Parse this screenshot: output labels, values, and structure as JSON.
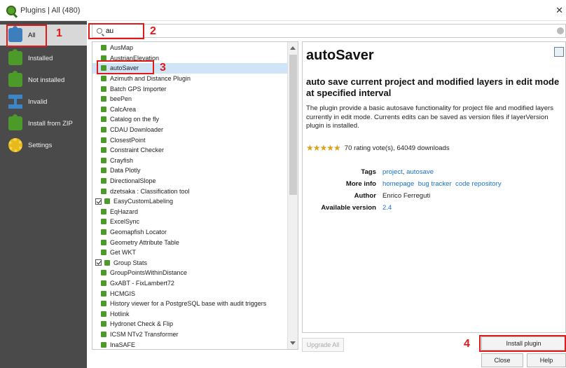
{
  "window": {
    "title": "Plugins | All (480)"
  },
  "sidebar": {
    "items": [
      {
        "label": "All",
        "icon": "puzzle-all-icon"
      },
      {
        "label": "Installed",
        "icon": "puzzle-installed-icon"
      },
      {
        "label": "Not installed",
        "icon": "puzzle-not-installed-icon"
      },
      {
        "label": "Invalid",
        "icon": "puzzle-invalid-icon"
      },
      {
        "label": "Install from ZIP",
        "icon": "puzzle-zip-icon"
      },
      {
        "label": "Settings",
        "icon": "gear-icon"
      }
    ]
  },
  "search": {
    "value": "au",
    "placeholder": ""
  },
  "annotations": [
    "1",
    "2",
    "3",
    "4"
  ],
  "plugins": [
    {
      "name": "AusMap",
      "checkbox": false
    },
    {
      "name": "AustrianElevation",
      "checkbox": false
    },
    {
      "name": "autoSaver",
      "checkbox": false,
      "selected": true
    },
    {
      "name": "Azimuth and Distance Plugin",
      "checkbox": false
    },
    {
      "name": "Batch GPS Importer",
      "checkbox": false
    },
    {
      "name": "beePen",
      "checkbox": false
    },
    {
      "name": "CalcArea",
      "checkbox": false
    },
    {
      "name": "Catalog on the fly",
      "checkbox": false
    },
    {
      "name": "CDAU Downloader",
      "checkbox": false
    },
    {
      "name": "ClosestPoint",
      "checkbox": false
    },
    {
      "name": "Constraint Checker",
      "checkbox": false
    },
    {
      "name": "Crayfish",
      "checkbox": false
    },
    {
      "name": "Data Plotly",
      "checkbox": false
    },
    {
      "name": "DirectionalSlope",
      "checkbox": false
    },
    {
      "name": "dzetsaka : Classification tool",
      "checkbox": false
    },
    {
      "name": "EasyCustomLabeling",
      "checkbox": true
    },
    {
      "name": "EqHazard",
      "checkbox": false
    },
    {
      "name": "ExcelSync",
      "checkbox": false
    },
    {
      "name": "Geomapfish Locator",
      "checkbox": false
    },
    {
      "name": "Geometry Attribute Table",
      "checkbox": false
    },
    {
      "name": "Get WKT",
      "checkbox": false
    },
    {
      "name": "Group Stats",
      "checkbox": true
    },
    {
      "name": "GroupPointsWithinDistance",
      "checkbox": false
    },
    {
      "name": "GxABT - FixLambert72",
      "checkbox": false
    },
    {
      "name": "HCMGIS",
      "checkbox": false
    },
    {
      "name": "History viewer for a PostgreSQL base with audit triggers",
      "checkbox": false
    },
    {
      "name": "Hotlink",
      "checkbox": false
    },
    {
      "name": "Hydronet Check & Flip",
      "checkbox": false
    },
    {
      "name": "ICSM NTv2 Transformer",
      "checkbox": false
    },
    {
      "name": "InaSAFE",
      "checkbox": false
    }
  ],
  "details": {
    "name": "autoSaver",
    "summary": "auto save current project and modified layers in edit mode at specified interval",
    "description": "The plugin provide a basic autosave functionality for project file and modified layers currently in edit mode. Currents edits can be saved as version files if layerVersion plugin is installed.",
    "stars": "★★★★★",
    "rating_text": "70 rating vote(s), 64049 downloads",
    "tags_label": "Tags",
    "tags": [
      "project",
      "autosave"
    ],
    "more_info_label": "More info",
    "more_info_links": [
      "homepage",
      "bug tracker",
      "code repository"
    ],
    "author_label": "Author",
    "author": "Enrico Ferreguti",
    "version_label": "Available version",
    "version": "2.4"
  },
  "buttons": {
    "upgrade_all": "Upgrade All",
    "install_plugin": "Install plugin",
    "close": "Close",
    "help": "Help"
  },
  "colors": {
    "annotation": "#e01919",
    "sidebar_bg": "#4a4a4a",
    "link": "#1a73c8",
    "plugin_icon": "#4c9a2a"
  }
}
